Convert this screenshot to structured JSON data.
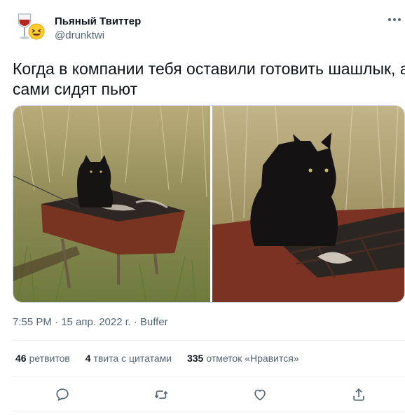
{
  "author": {
    "display_name": "Пьяный Твиттер",
    "handle": "@drunktwi",
    "avatar_icon": "wine-glass-emoji-icon"
  },
  "tweet": {
    "text_line1": "Когда в компании тебя оставили готовить шашлык, а",
    "text_line2": "сами сидят пьют"
  },
  "media": {
    "photos": [
      {
        "subject": "black-cat-on-grill-wide"
      },
      {
        "subject": "black-cat-on-grill-closeup"
      }
    ]
  },
  "meta": {
    "time": "7:55 PM",
    "date": "15 апр. 2022 г.",
    "source": "Buffer",
    "separator": "·"
  },
  "stats": {
    "retweets_count": "46",
    "retweets_label": "ретвитов",
    "quotes_count": "4",
    "quotes_label": "твита с цитатами",
    "likes_count": "335",
    "likes_label": "отметок «Нравится»"
  },
  "colors": {
    "text": "#0f1419",
    "secondary": "#536471",
    "divider": "#eff3f4"
  }
}
